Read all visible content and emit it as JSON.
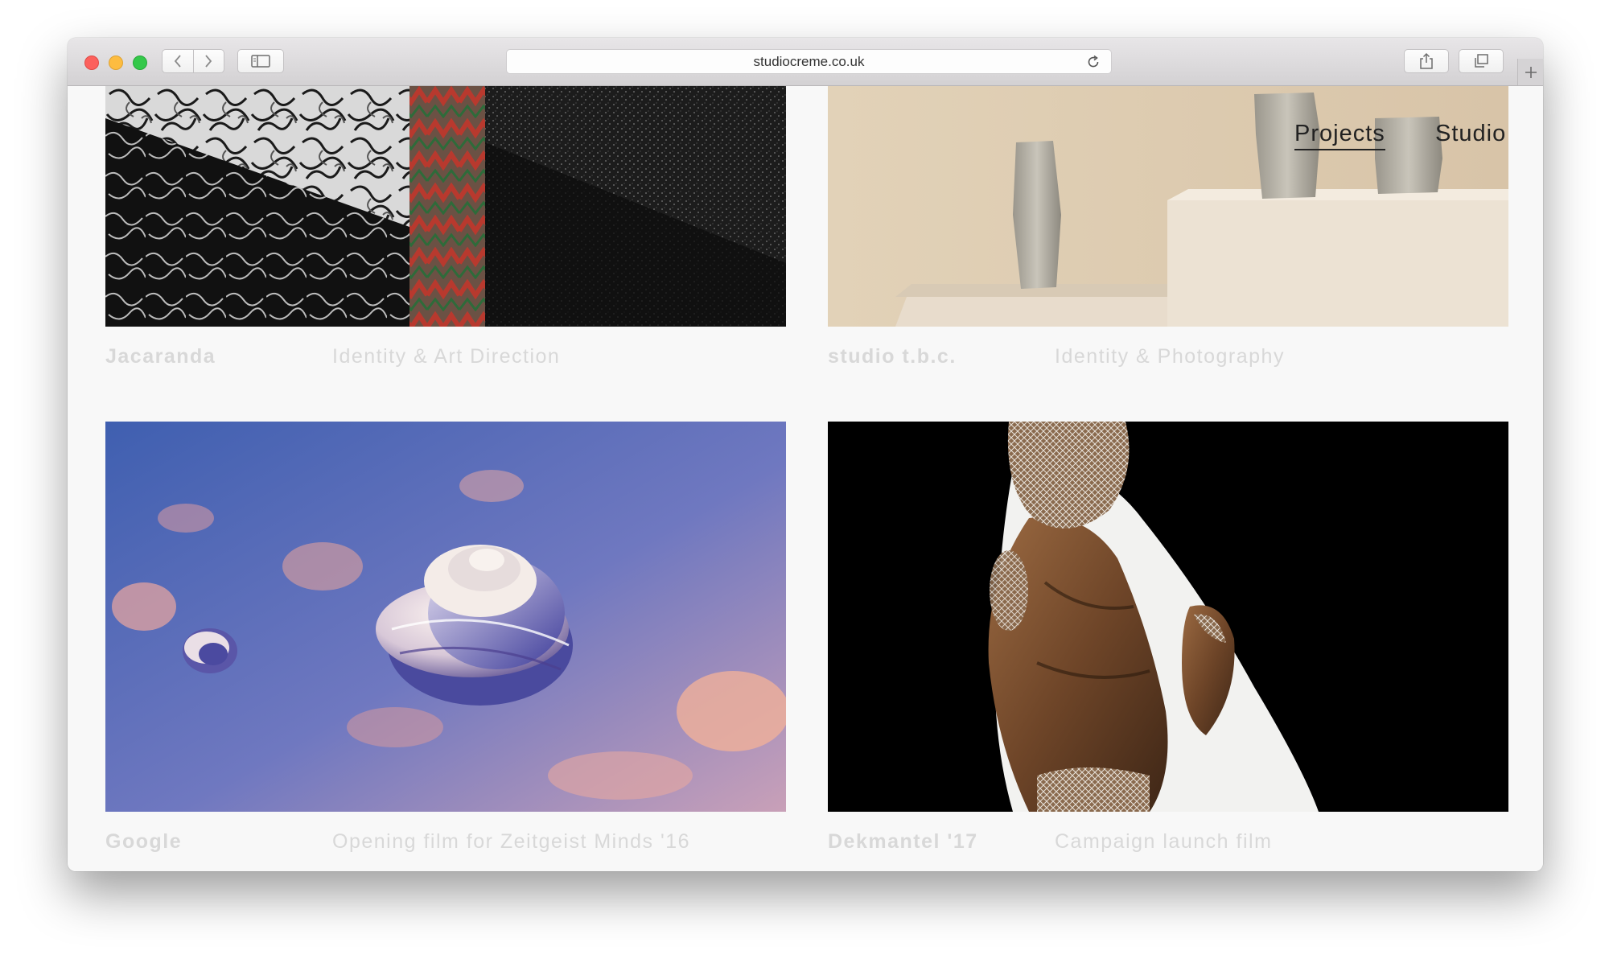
{
  "browser": {
    "url": "studiocreme.co.uk",
    "icons": [
      "back-chevron-icon",
      "forward-chevron-icon",
      "sidebar-icon",
      "reload-icon",
      "share-icon",
      "tabs-icon",
      "plus-icon"
    ]
  },
  "site_nav": {
    "items": [
      {
        "label": "Projects",
        "active": true
      },
      {
        "label": "Studio",
        "active": false
      }
    ]
  },
  "projects": [
    {
      "title": "Jacaranda",
      "description": "Identity & Art Direction"
    },
    {
      "title": "studio t.b.c.",
      "description": "Identity & Photography"
    },
    {
      "title": "Google",
      "description": "Opening film for Zeitgeist Minds '16"
    },
    {
      "title": "Dekmantel '17",
      "description": "Campaign launch film"
    }
  ]
}
